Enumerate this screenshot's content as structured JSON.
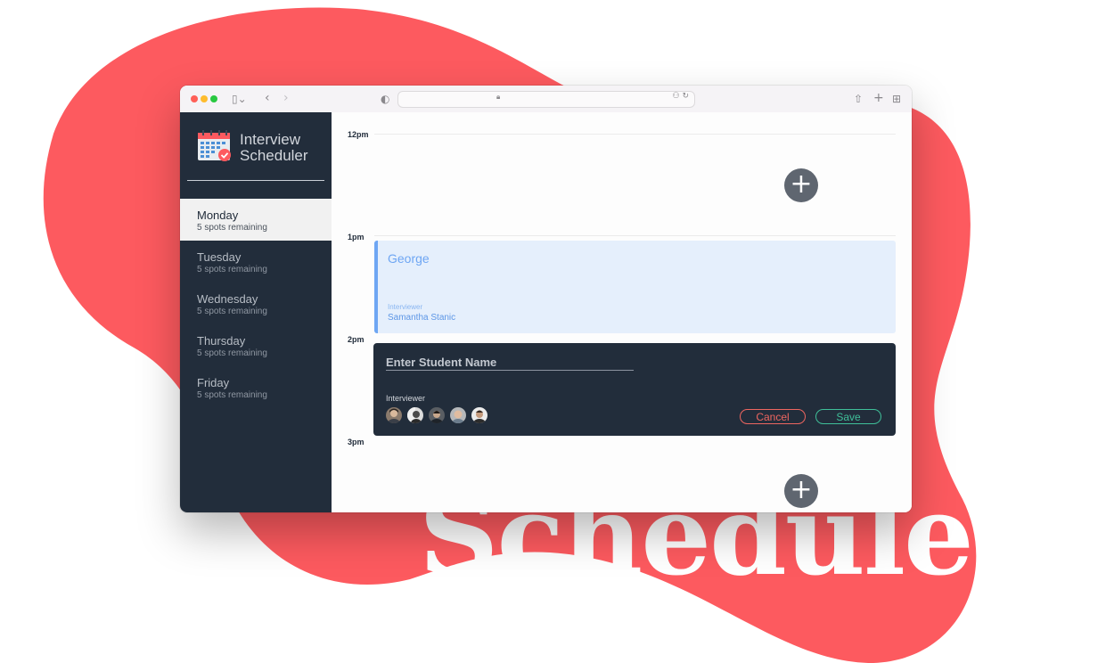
{
  "hero": {
    "word": "Scheduler"
  },
  "browser": {
    "lock_icon": "lock-icon",
    "address_right_icons": "⚇ ↻"
  },
  "app": {
    "logo_icon": "calendar-icon",
    "logo_line1": "Interview",
    "logo_line2": "Scheduler"
  },
  "days": [
    {
      "name": "Monday",
      "spots": "5 spots remaining",
      "selected": true
    },
    {
      "name": "Tuesday",
      "spots": "5 spots remaining",
      "selected": false
    },
    {
      "name": "Wednesday",
      "spots": "5 spots remaining",
      "selected": false
    },
    {
      "name": "Thursday",
      "spots": "5 spots remaining",
      "selected": false
    },
    {
      "name": "Friday",
      "spots": "5 spots remaining",
      "selected": false
    }
  ],
  "schedule": {
    "hours": [
      "12pm",
      "1pm",
      "2pm",
      "3pm"
    ],
    "add_button": "+",
    "appointment": {
      "student": "George",
      "interviewer_label": "Interviewer",
      "interviewer_name": "Samantha Stanic"
    },
    "form": {
      "placeholder": "Enter Student Name",
      "interviewer_label": "Interviewer",
      "cancel_label": "Cancel",
      "save_label": "Save",
      "avatar_count": 5
    }
  },
  "colors": {
    "blob": "#fd5a5f",
    "sidebar": "#222d3b",
    "appointment_bg": "#e5effc",
    "appointment_accent": "#6ea6f3",
    "cancel": "#ee6660",
    "save": "#3fbf99"
  }
}
